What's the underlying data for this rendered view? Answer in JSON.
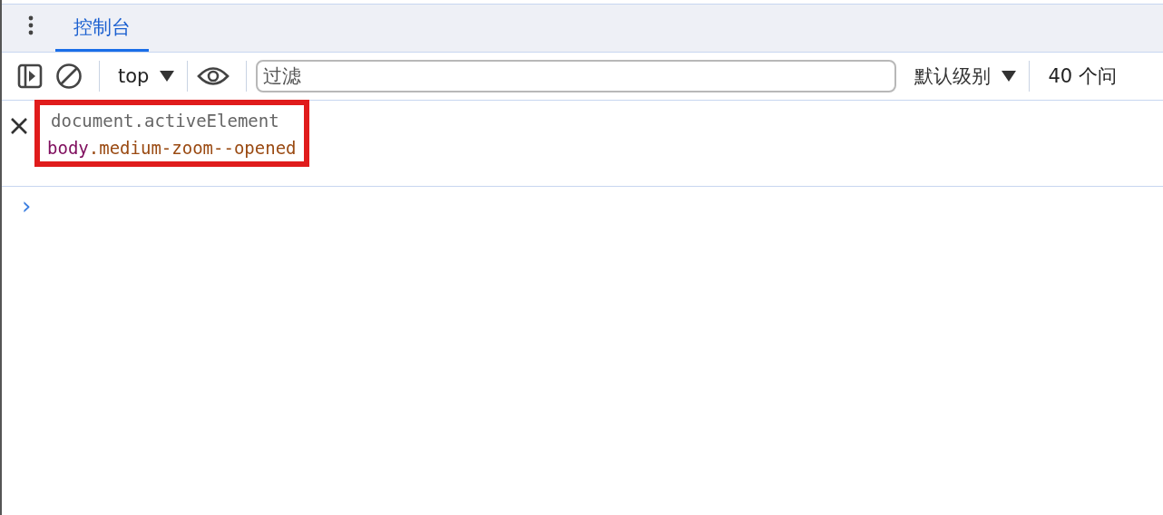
{
  "tabs": [
    {
      "label": "控制台",
      "selected": true
    }
  ],
  "toolbar": {
    "context": "top",
    "filter": {
      "placeholder": "过滤"
    },
    "levels": "默认级别",
    "issues": "40 个问"
  },
  "entries": [
    {
      "input": "document.activeElement",
      "result": {
        "tag": "body",
        "classes": ".medium-zoom--opened"
      },
      "highlighted": true
    }
  ],
  "prompt": "›"
}
